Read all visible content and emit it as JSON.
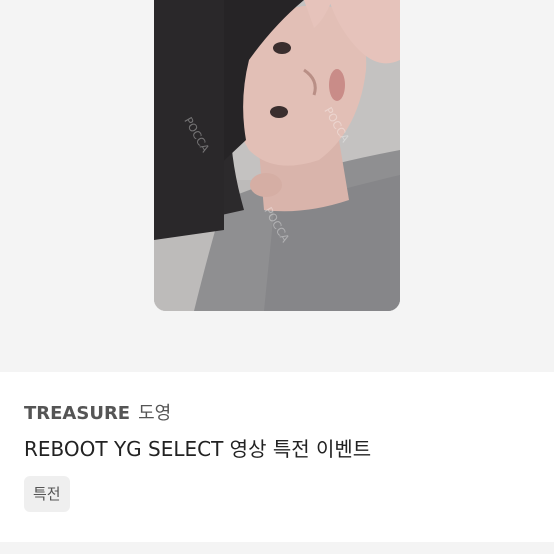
{
  "product": {
    "image_alt": "TREASURE 도영 REBOOT YG SELECT 영상 특전 이벤트",
    "watermark_text": "POCCA",
    "artist": "TREASURE",
    "member": "도영",
    "title": "REBOOT YG SELECT 영상 특전 이벤트",
    "tag": "특전"
  },
  "colors": {
    "background": "#f4f4f4",
    "card_surface": "#ffffff",
    "tag_background": "#efefef",
    "text_primary": "#222222",
    "text_secondary": "#555555"
  }
}
